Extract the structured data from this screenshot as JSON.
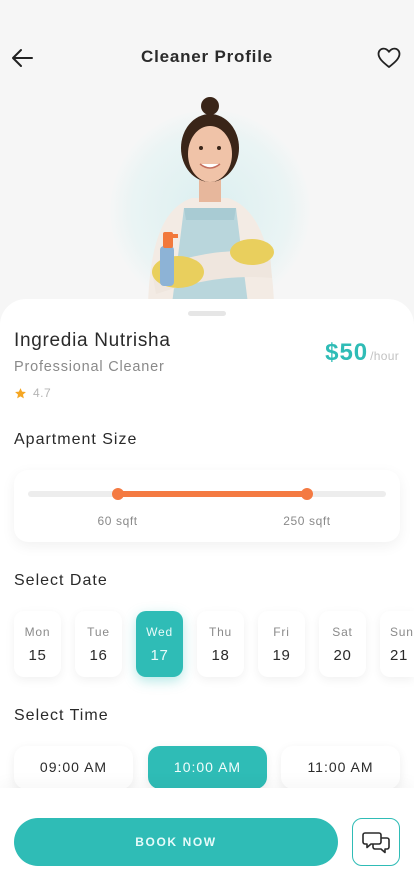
{
  "header": {
    "title": "Cleaner Profile",
    "back_icon": "arrow-left-icon",
    "favorite_icon": "heart-icon"
  },
  "profile": {
    "name": "Ingredia Nutrisha",
    "role": "Professional Cleaner",
    "rating": "4.7",
    "price": "$50",
    "price_unit": "/hour"
  },
  "apartment_size": {
    "label": "Apartment Size",
    "min_label": "60 sqft",
    "max_label": "250 sqft",
    "range_min_fraction": 0.25,
    "range_max_fraction": 0.78
  },
  "select_date": {
    "label": "Select Date",
    "days": [
      {
        "dow": "Mon",
        "day": "15",
        "selected": false
      },
      {
        "dow": "Tue",
        "day": "16",
        "selected": false
      },
      {
        "dow": "Wed",
        "day": "17",
        "selected": true
      },
      {
        "dow": "Thu",
        "day": "18",
        "selected": false
      },
      {
        "dow": "Fri",
        "day": "19",
        "selected": false
      },
      {
        "dow": "Sat",
        "day": "20",
        "selected": false
      },
      {
        "dow": "Sun",
        "day": "21",
        "selected": false
      }
    ]
  },
  "select_time": {
    "label": "Select Time",
    "slots": [
      {
        "label": "09:00 AM",
        "selected": false
      },
      {
        "label": "10:00 AM",
        "selected": true
      },
      {
        "label": "11:00 AM",
        "selected": false
      }
    ]
  },
  "actions": {
    "book_label": "BOOK NOW",
    "chat_icon": "chat-bubbles-icon"
  },
  "colors": {
    "accent": "#2fbcb6",
    "range": "#f47a42",
    "star": "#f5a623"
  }
}
